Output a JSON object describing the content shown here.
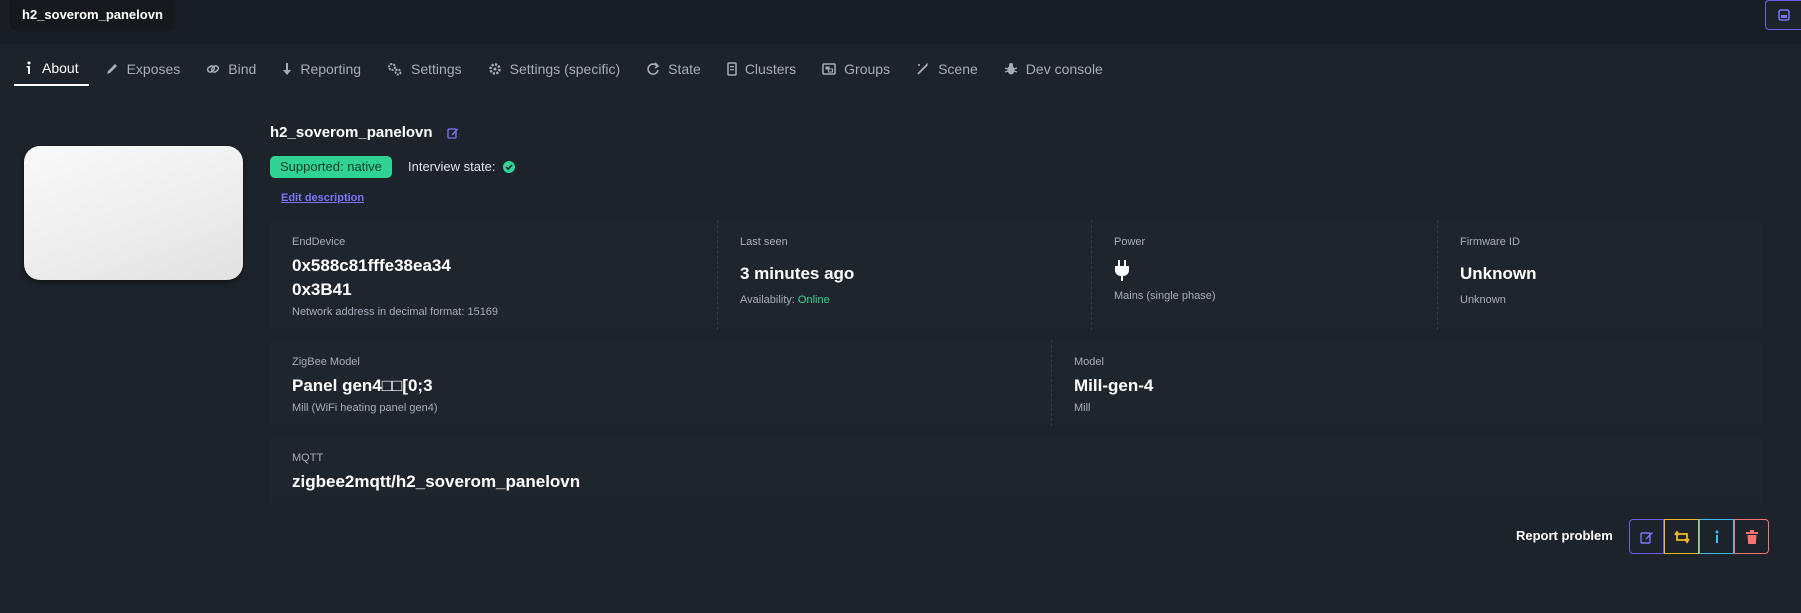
{
  "window": {
    "title": "h2_soverom_panelovn"
  },
  "tabs": [
    {
      "label": "About",
      "icon": "info-icon",
      "active": true
    },
    {
      "label": "Exposes",
      "icon": "pencil-icon"
    },
    {
      "label": "Bind",
      "icon": "link-icon"
    },
    {
      "label": "Reporting",
      "icon": "arrow-down-icon"
    },
    {
      "label": "Settings",
      "icon": "cogs-icon"
    },
    {
      "label": "Settings (specific)",
      "icon": "gear-icon"
    },
    {
      "label": "State",
      "icon": "refresh-icon"
    },
    {
      "label": "Clusters",
      "icon": "document-icon"
    },
    {
      "label": "Groups",
      "icon": "groups-icon"
    },
    {
      "label": "Scene",
      "icon": "magic-wand-icon"
    },
    {
      "label": "Dev console",
      "icon": "bug-icon"
    }
  ],
  "device": {
    "name": "h2_soverom_panelovn",
    "support_badge": "Supported: native",
    "interview_label": "Interview state:",
    "edit_description": "Edit description"
  },
  "stats_row1": {
    "enddevice": {
      "title": "EndDevice",
      "ieee": "0x588c81fffe38ea34",
      "nwk": "0x3B41",
      "desc": "Network address in decimal format: 15169"
    },
    "last_seen": {
      "title": "Last seen",
      "value": "3 minutes ago",
      "availability_label": "Availability:",
      "availability_value": "Online"
    },
    "power": {
      "title": "Power",
      "desc": "Mains (single phase)"
    },
    "firmware": {
      "title": "Firmware ID",
      "value": "Unknown",
      "desc": "Unknown"
    }
  },
  "stats_row2": {
    "zigbee_model": {
      "title": "ZigBee Model",
      "value": "Panel gen4□□[0;3",
      "desc": "Mill (WiFi heating panel gen4)"
    },
    "model": {
      "title": "Model",
      "value": "Mill-gen-4",
      "desc": "Mill"
    }
  },
  "stats_row3": {
    "mqtt": {
      "title": "MQTT",
      "value": "zigbee2mqtt/h2_soverom_panelovn"
    }
  },
  "actions": {
    "report_problem": "Report problem"
  },
  "colors": {
    "background": "#1d232a",
    "supported": "#2fd394",
    "online": "#2fd394",
    "edit": "#6c5ce7",
    "swap": "#f5b924",
    "info": "#3abff8",
    "delete": "#f87272"
  }
}
